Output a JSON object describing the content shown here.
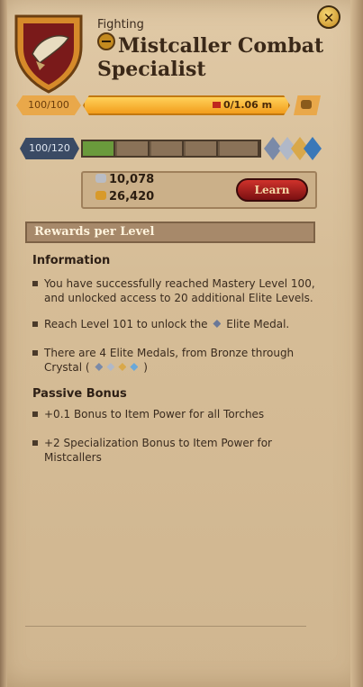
{
  "header": {
    "category": "Fighting",
    "title": "Mistcaller Combat Specialist",
    "close_icon": "close-icon"
  },
  "fame": {
    "level_text": "100/100",
    "progress_text": "0/1.06 m",
    "progress_fraction": 0
  },
  "mastery": {
    "level_text": "100/120",
    "progress_fraction": 0.2,
    "segments": 5
  },
  "cost": {
    "silver": "10,078",
    "gold": "26,420",
    "learn_label": "Learn"
  },
  "rewards_header": "Rewards per Level",
  "information": {
    "heading": "Information",
    "items": [
      "You have successfully reached Mastery Level 100, and unlocked access to 20 additional Elite Levels.",
      "Reach Level 101 to unlock the",
      "Elite Medal.",
      "There are 4 Elite Medals, from Bronze through Crystal (",
      ")"
    ]
  },
  "passive": {
    "heading": "Passive Bonus",
    "items": [
      "+0.1 Bonus to Item Power for all Torches",
      "+2 Specialization Bonus to Item Power for Mistcallers"
    ]
  },
  "colors": {
    "fame_bar": "#f0a830",
    "mastery_fill": "#6a9a3c",
    "learn_button": "#c0281e"
  }
}
